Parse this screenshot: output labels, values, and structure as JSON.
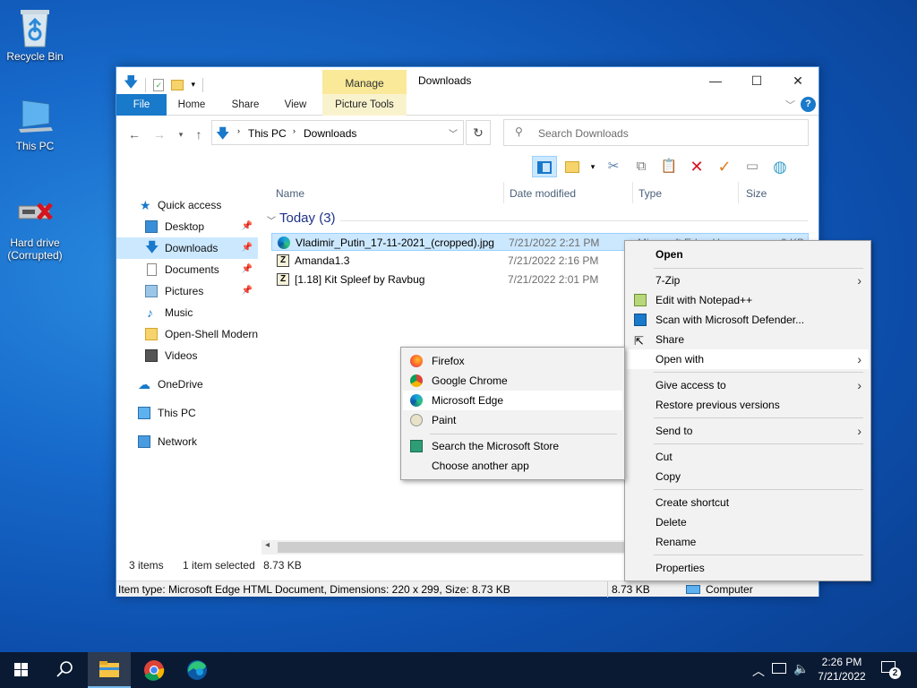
{
  "desktop": {
    "icons": [
      {
        "label": "Recycle Bin",
        "icon": "recycle-bin-icon"
      },
      {
        "label": "This PC",
        "icon": "computer-icon"
      },
      {
        "label": "Hard drive (Corrupted)",
        "icon": "hard-drive-corrupted-icon"
      }
    ]
  },
  "explorer": {
    "title": "Downloads",
    "contextual_tab": "Manage",
    "tabs": [
      "File",
      "Home",
      "Share",
      "View",
      "Picture Tools"
    ],
    "address": [
      "This PC",
      "Downloads"
    ],
    "search_placeholder": "Search Downloads",
    "columns": [
      "Name",
      "Date modified",
      "Type",
      "Size"
    ],
    "group_label": "Today (3)",
    "files": [
      {
        "name": "Vladimir_Putin_17-11-2021_(cropped).jpg",
        "date": "7/21/2022 2:21 PM",
        "type": "Microsoft Edge H",
        "size": "9 KB",
        "icon": "edge-html-icon"
      },
      {
        "name": "Amanda1.3",
        "date": "7/21/2022 2:16 PM",
        "icon": "zip-archive-icon"
      },
      {
        "name": "[1.18] Kit Spleef by Ravbug",
        "date": "7/21/2022 2:01 PM",
        "icon": "zip-archive-icon"
      }
    ],
    "nav": {
      "quick_access": "Quick access",
      "items": [
        "Desktop",
        "Downloads",
        "Documents",
        "Pictures",
        "Music",
        "Open-Shell Modern",
        "Videos"
      ],
      "onedrive": "OneDrive",
      "this_pc": "This PC",
      "network": "Network"
    },
    "status": {
      "count": "3 items",
      "selected": "1 item selected",
      "size": "8.73 KB"
    },
    "details_bar": {
      "info": "Item type: Microsoft Edge HTML Document, Dimensions: 220 x 299, Size: 8.73 KB",
      "size": "8.73 KB",
      "location": "Computer"
    }
  },
  "context_menu": {
    "items": [
      {
        "label": "Open",
        "bold": true
      },
      {
        "label": "7-Zip",
        "submenu": true
      },
      {
        "label": "Edit with Notepad++",
        "icon": "notepadpp-icon"
      },
      {
        "label": "Scan with Microsoft Defender...",
        "icon": "defender-icon"
      },
      {
        "label": "Share",
        "icon": "share-icon"
      },
      {
        "label": "Open with",
        "submenu": true,
        "highlighted": true
      },
      {
        "label": "Give access to",
        "submenu": true
      },
      {
        "label": "Restore previous versions"
      },
      {
        "label": "Send to",
        "submenu": true
      },
      {
        "label": "Cut"
      },
      {
        "label": "Copy"
      },
      {
        "label": "Create shortcut"
      },
      {
        "label": "Delete"
      },
      {
        "label": "Rename"
      },
      {
        "label": "Properties"
      }
    ]
  },
  "open_with_menu": {
    "items": [
      {
        "label": "Firefox",
        "icon": "firefox-icon"
      },
      {
        "label": "Google Chrome",
        "icon": "chrome-icon"
      },
      {
        "label": "Microsoft Edge",
        "icon": "edge-icon",
        "highlighted": true
      },
      {
        "label": "Paint",
        "icon": "paint-icon"
      },
      {
        "label": "Search the Microsoft Store",
        "icon": "store-icon"
      },
      {
        "label": "Choose another app"
      }
    ]
  },
  "taskbar": {
    "time": "2:26 PM",
    "date": "7/21/2022",
    "notifications": "2"
  },
  "colors": {
    "accent": "#1979ca",
    "selection": "#cce8ff",
    "manage_tab": "#f9e998"
  }
}
